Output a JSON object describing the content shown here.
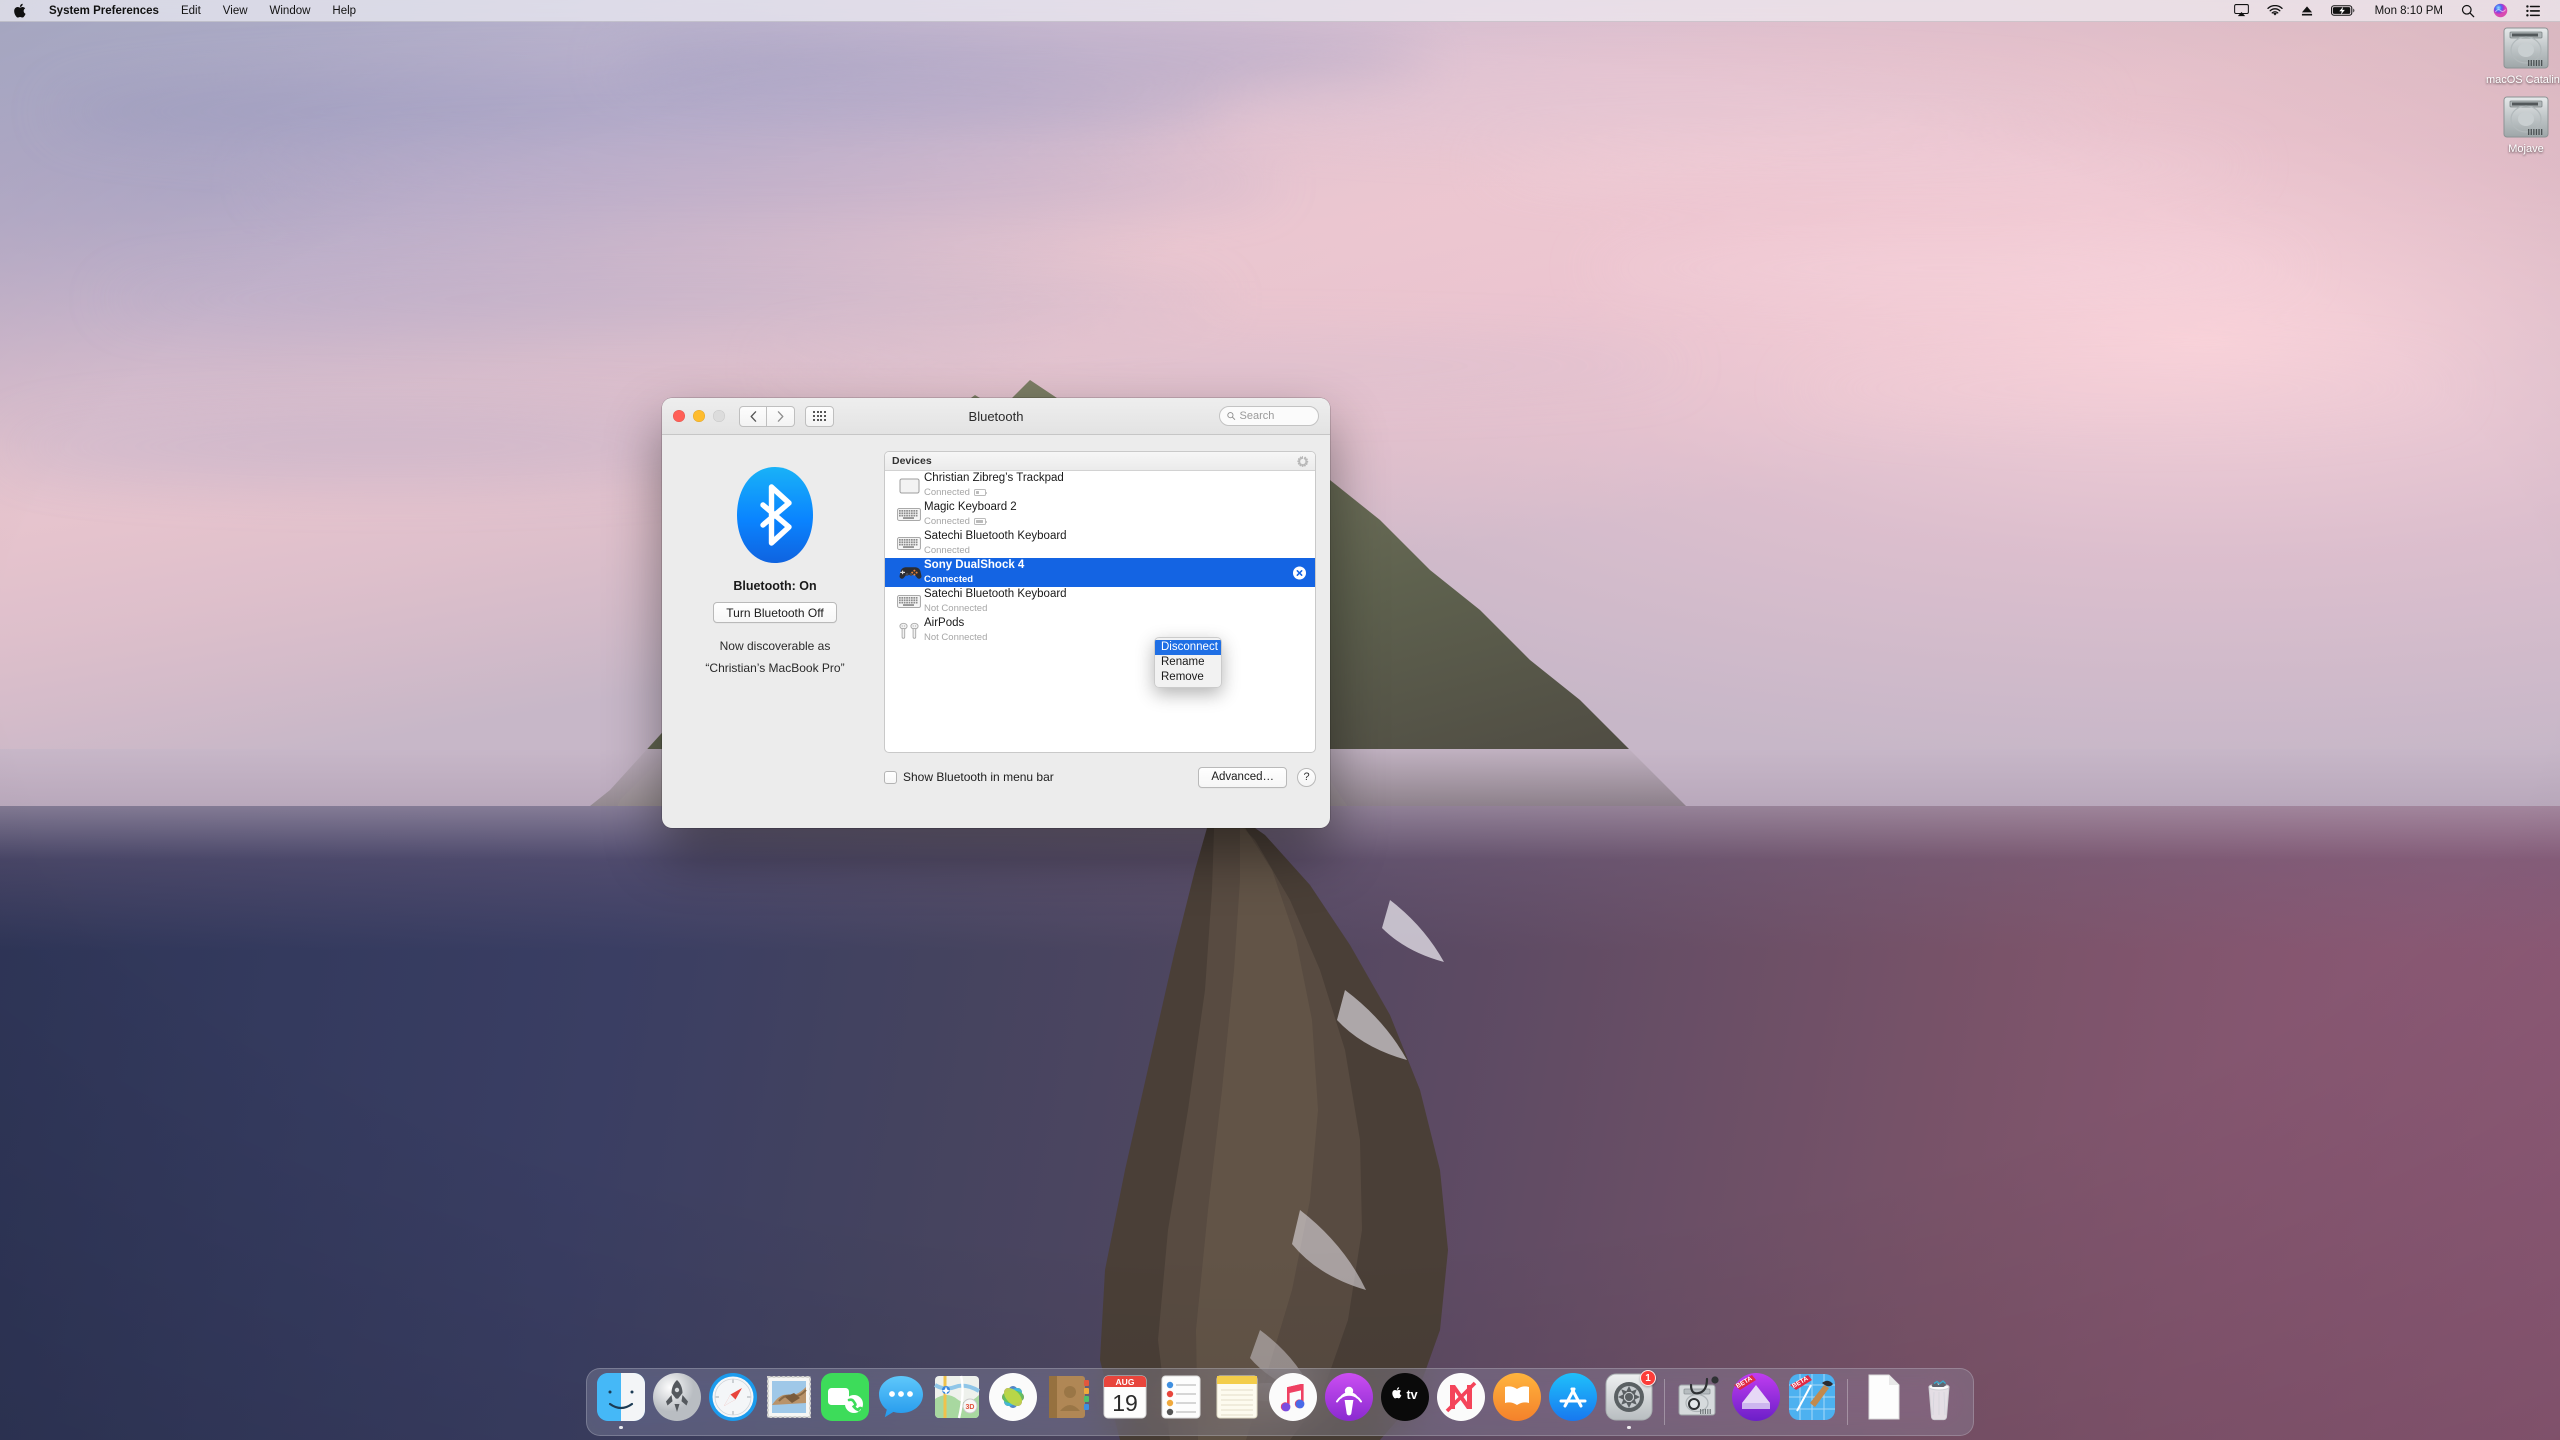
{
  "menubar": {
    "apple_icon": "apple-logo-icon",
    "items": [
      {
        "label": "System Preferences",
        "bold": true
      },
      {
        "label": "Edit",
        "bold": false
      },
      {
        "label": "View",
        "bold": false
      },
      {
        "label": "Window",
        "bold": false
      },
      {
        "label": "Help",
        "bold": false
      }
    ],
    "status_icons": [
      "airplay-icon",
      "wifi-icon",
      "eject-icon",
      "battery-charging-icon"
    ],
    "time": "Mon 8:10 PM",
    "right_icons": [
      "spotlight-search-icon",
      "siri-icon",
      "control-center-icon"
    ]
  },
  "desktop": {
    "icons": [
      {
        "label": "macOS Catalina",
        "type": "hard-drive"
      },
      {
        "label": "Mojave",
        "type": "hard-drive"
      }
    ]
  },
  "window": {
    "title": "Bluetooth",
    "search": {
      "value": "",
      "placeholder": "Search"
    },
    "nav": {
      "back": "‹",
      "forward": "›",
      "grid": "show-all-grid-icon"
    },
    "traffic": {
      "close": "close",
      "minimize": "minimize",
      "zoom": "zoom"
    }
  },
  "bluetooth": {
    "logo_icon": "bluetooth-logo",
    "status_label": "Bluetooth: On",
    "toggle_button": "Turn Bluetooth Off",
    "discoverable_line1": "Now discoverable as",
    "discoverable_line2": "“Christian’s MacBook Pro”",
    "devices_header": "Devices",
    "devices": [
      {
        "name": "Christian Zibreg’s Trackpad",
        "status": "Connected",
        "icon": "trackpad-icon",
        "battery": 35,
        "selected": false
      },
      {
        "name": "Magic Keyboard 2",
        "status": "Connected",
        "icon": "keyboard-icon",
        "battery": 75,
        "selected": false
      },
      {
        "name": "Satechi Bluetooth Keyboard",
        "status": "Connected",
        "icon": "keyboard-icon",
        "battery": null,
        "selected": false
      },
      {
        "name": "Sony DualShock 4",
        "status": "Connected",
        "icon": "gamepad-icon",
        "battery": null,
        "selected": true
      },
      {
        "name": "Satechi Bluetooth Keyboard",
        "status": "Not Connected",
        "icon": "keyboard-icon",
        "battery": null,
        "selected": false
      },
      {
        "name": "AirPods",
        "status": "Not Connected",
        "icon": "airpods-icon",
        "battery": null,
        "selected": false
      }
    ],
    "show_in_menubar_label": "Show Bluetooth in menu bar",
    "show_in_menubar_checked": false,
    "advanced_button": "Advanced…",
    "help_button": "?"
  },
  "context_menu": {
    "items": [
      {
        "label": "Disconnect",
        "highlighted": true
      },
      {
        "label": "Rename",
        "highlighted": false
      },
      {
        "label": "Remove",
        "highlighted": false
      }
    ]
  },
  "dock": {
    "items": [
      {
        "name": "finder",
        "running": true
      },
      {
        "name": "launchpad",
        "running": false
      },
      {
        "name": "safari",
        "running": false
      },
      {
        "name": "mail",
        "running": false
      },
      {
        "name": "facetime",
        "running": false
      },
      {
        "name": "messages",
        "running": false
      },
      {
        "name": "maps",
        "running": false
      },
      {
        "name": "photos",
        "running": false
      },
      {
        "name": "contacts",
        "running": false
      },
      {
        "name": "calendar",
        "running": false,
        "month": "AUG",
        "day": "19"
      },
      {
        "name": "reminders",
        "running": false
      },
      {
        "name": "notes",
        "running": false
      },
      {
        "name": "music",
        "running": false
      },
      {
        "name": "podcasts",
        "running": false
      },
      {
        "name": "appletv",
        "running": false
      },
      {
        "name": "news",
        "running": false
      },
      {
        "name": "books",
        "running": false
      },
      {
        "name": "appstore",
        "running": false
      },
      {
        "name": "system-preferences",
        "running": true,
        "badge": "1"
      },
      {
        "name": "disk-utility",
        "running": false
      },
      {
        "name": "parallels",
        "running": false,
        "ribbon": "BETA"
      },
      {
        "name": "xcode",
        "running": false,
        "ribbon": "BETA"
      },
      {
        "name": "document",
        "running": false
      },
      {
        "name": "trash",
        "running": false
      }
    ]
  },
  "colors": {
    "accent_blue": "#1464e3",
    "bluetooth_blue": "#0a84ff",
    "badge_red": "#fc3d39",
    "window_bg": "#ececec"
  }
}
